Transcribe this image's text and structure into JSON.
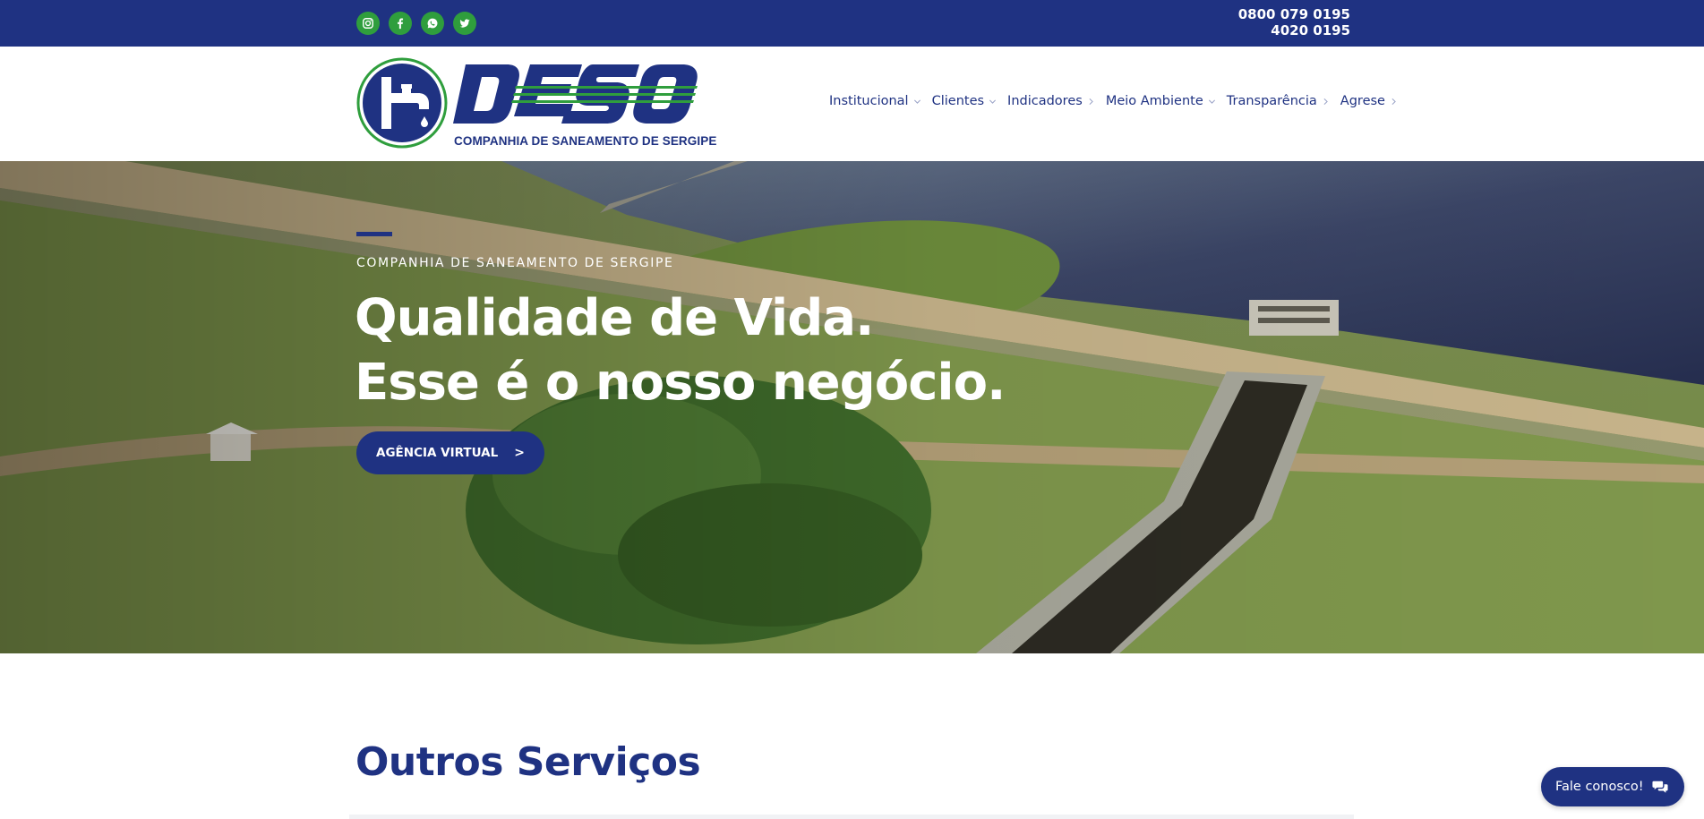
{
  "topbar": {
    "social": [
      {
        "name": "instagram-icon"
      },
      {
        "name": "facebook-icon"
      },
      {
        "name": "whatsapp-icon"
      },
      {
        "name": "twitter-icon"
      }
    ],
    "phone_1": "0800 079 0195",
    "phone_2": "4020 0195"
  },
  "header": {
    "logo_word": "DESO",
    "logo_tagline": "COMPANHIA DE SANEAMENTO DE SERGIPE",
    "nav": [
      {
        "label": "Institucional",
        "chevron": "down"
      },
      {
        "label": "Clientes",
        "chevron": "down"
      },
      {
        "label": "Indicadores",
        "chevron": "right"
      },
      {
        "label": "Meio Ambiente",
        "chevron": "down"
      },
      {
        "label": "Transparência",
        "chevron": "right"
      },
      {
        "label": "Agrese",
        "chevron": "right"
      }
    ]
  },
  "hero": {
    "kicker": "COMPANHIA DE SANEAMENTO DE SERGIPE",
    "title_line_1": "Qualidade de Vida.",
    "title_line_2": "Esse é o nosso negócio.",
    "button_label": "AGÊNCIA VIRTUAL",
    "button_arrow": ">"
  },
  "services": {
    "title": "Outros Serviços"
  },
  "chat": {
    "label": "Fale conosco!"
  },
  "colors": {
    "brand_blue": "#1f3282",
    "brand_green": "#2f9e3d",
    "white": "#ffffff"
  }
}
